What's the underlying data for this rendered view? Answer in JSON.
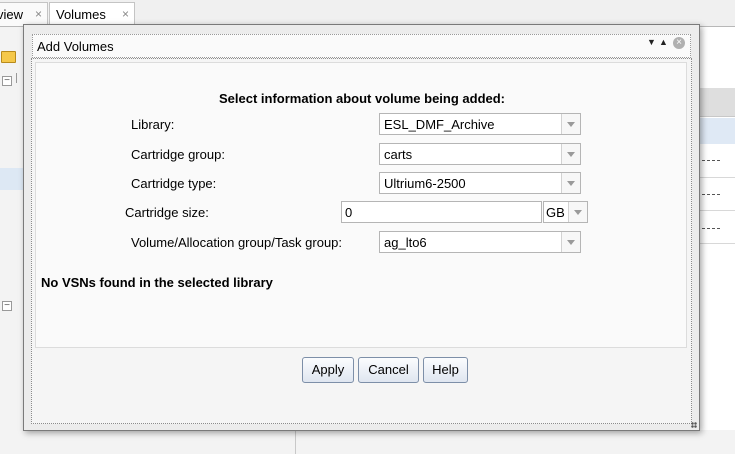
{
  "tabs": [
    {
      "label": "view",
      "close": "×"
    },
    {
      "label": "Volumes",
      "close": "×"
    }
  ],
  "tree": {
    "expander": "−"
  },
  "dialog": {
    "title": "Add Volumes",
    "controls": {
      "minimize": "▼",
      "maximize": "▲",
      "close": "×"
    },
    "heading": "Select information about volume being added:",
    "fields": {
      "library": {
        "label": "Library:",
        "value": "ESL_DMF_Archive"
      },
      "cartridge_group": {
        "label": "Cartridge group:",
        "value": "carts"
      },
      "cartridge_type": {
        "label": "Cartridge type:",
        "value": "Ultrium6-2500"
      },
      "cartridge_size": {
        "label": "Cartridge size:",
        "value": "0",
        "unit": "GB"
      },
      "volume_group": {
        "label": "Volume/Allocation group/Task group:",
        "value": "ag_lto6"
      }
    },
    "status_message": "No VSNs found in the selected library",
    "buttons": {
      "apply": "Apply",
      "cancel": "Cancel",
      "help": "Help"
    }
  }
}
